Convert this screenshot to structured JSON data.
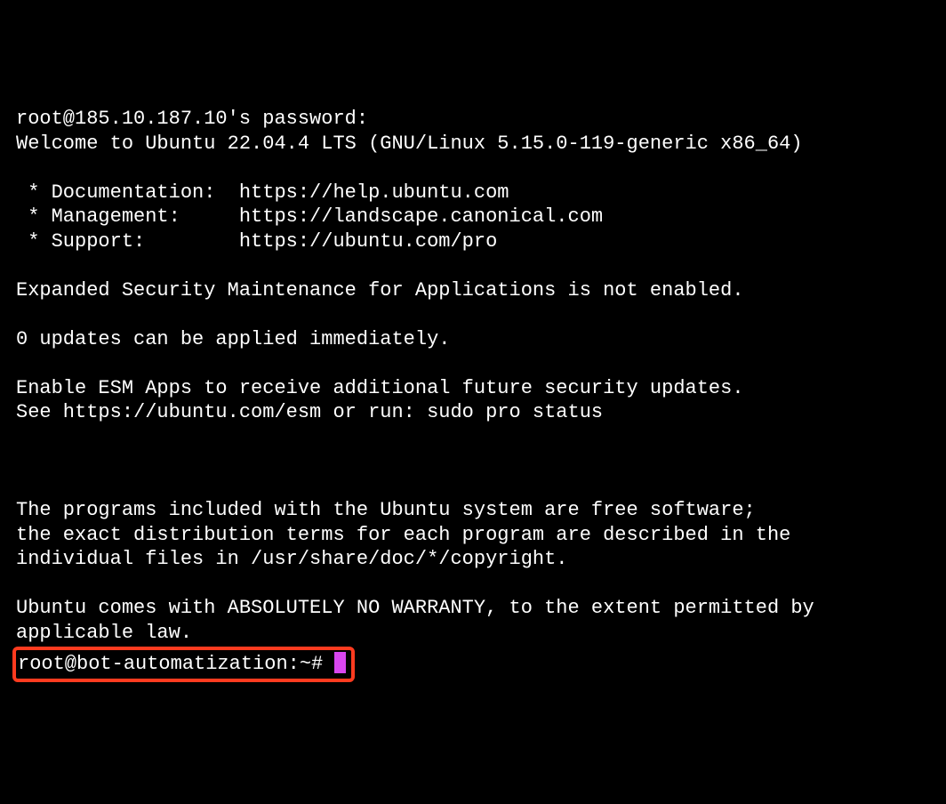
{
  "terminal": {
    "line1": "root@185.10.187.10's password:",
    "line2": "Welcome to Ubuntu 22.04.4 LTS (GNU/Linux 5.15.0-119-generic x86_64)",
    "blank1": "",
    "line3": " * Documentation:  https://help.ubuntu.com",
    "line4": " * Management:     https://landscape.canonical.com",
    "line5": " * Support:        https://ubuntu.com/pro",
    "blank2": "",
    "line6": "Expanded Security Maintenance for Applications is not enabled.",
    "blank3": "",
    "line7": "0 updates can be applied immediately.",
    "blank4": "",
    "line8": "Enable ESM Apps to receive additional future security updates.",
    "line9": "See https://ubuntu.com/esm or run: sudo pro status",
    "blank5": "",
    "blank6": "",
    "blank7": "",
    "line10": "The programs included with the Ubuntu system are free software;",
    "line11": "the exact distribution terms for each program are described in the",
    "line12": "individual files in /usr/share/doc/*/copyright.",
    "blank8": "",
    "line13": "Ubuntu comes with ABSOLUTELY NO WARRANTY, to the extent permitted by",
    "line14": "applicable law.",
    "prompt": "root@bot-automatization:~# "
  }
}
